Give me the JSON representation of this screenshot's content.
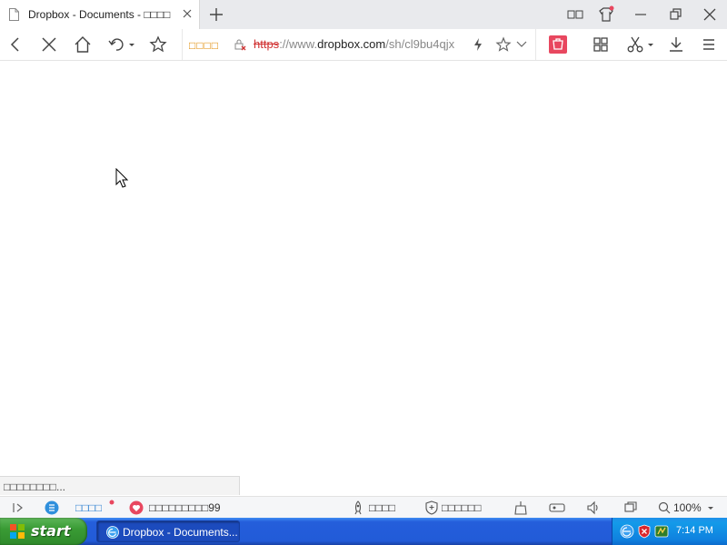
{
  "browser": {
    "tab": {
      "title": "Dropbox - Documents - □□□□"
    },
    "address": {
      "quick_label": "□□□□",
      "url_protocol": "https",
      "url_sep": "://www.",
      "url_domain": "dropbox.com",
      "url_path": "/sh/cl9bu4qjx"
    }
  },
  "status_bubble": "□□□□□□□□...",
  "statusbar": {
    "item1": "□□□□",
    "item2": "□□□□□□□□□99",
    "item3": "□□□□",
    "item4": "□□□□□□",
    "zoom": "100%"
  },
  "taskbar": {
    "start_label": "start",
    "window_title": "Dropbox - Documents...",
    "clock": "7:14 PM"
  },
  "colors": {
    "taskbar_blue": "#245edb",
    "start_green": "#3a9c35",
    "url_protocol_red": "#d03030",
    "quick_orange": "#e08a00",
    "badge_pink": "#e8475f"
  }
}
